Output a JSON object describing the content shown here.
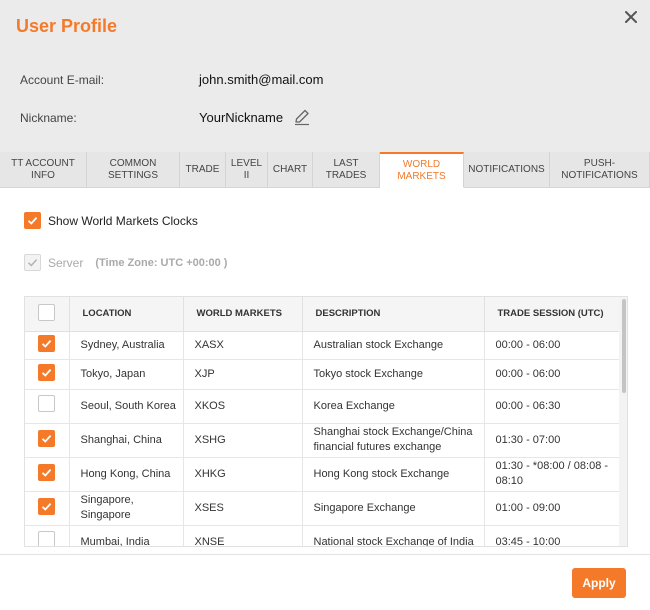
{
  "dialog": {
    "title": "User Profile",
    "accent_color": "#f47a2a"
  },
  "profile": {
    "email_label": "Account E-mail:",
    "email_value": "john.smith@mail.com",
    "nickname_label": "Nickname:",
    "nickname_value": "YourNickname"
  },
  "tabs": [
    {
      "label": "TT ACCOUNT\nINFO",
      "active": false
    },
    {
      "label": "COMMON\nSETTINGS",
      "active": false
    },
    {
      "label": "TRADE",
      "active": false
    },
    {
      "label": "LEVEL\nII",
      "active": false
    },
    {
      "label": "CHART",
      "active": false
    },
    {
      "label": "LAST\nTRADES",
      "active": false
    },
    {
      "label": "WORLD\nMARKETS",
      "active": true
    },
    {
      "label": "NOTIFICATIONS",
      "active": false
    },
    {
      "label": "PUSH-\nNOTIFICATIONS",
      "active": false
    }
  ],
  "options": {
    "show_clocks_label": "Show World Markets Clocks",
    "show_clocks_checked": true,
    "server_label": "Server",
    "server_checked": true,
    "timezone_text": "(Time Zone: UTC +00:00 )"
  },
  "table": {
    "columns": [
      "LOCATION",
      "WORLD MARKETS",
      "DESCRIPTION",
      "TRADE SESSION (UTC)"
    ],
    "rows": [
      {
        "checked": true,
        "location": "Sydney, Australia",
        "market": "XASX",
        "description": "Australian stock Exchange",
        "session": "00:00 - 06:00"
      },
      {
        "checked": true,
        "location": "Tokyo, Japan",
        "market": "XJP",
        "description": "Tokyo stock Exchange",
        "session": "00:00 - 06:00"
      },
      {
        "checked": false,
        "location": "Seoul, South Korea",
        "market": "XKOS",
        "description": "Korea Exchange",
        "session": "00:00 - 06:30"
      },
      {
        "checked": true,
        "location": "Shanghai, China",
        "market": "XSHG",
        "description": "Shanghai stock Exchange/China financial futures exchange",
        "session": "01:30 - 07:00"
      },
      {
        "checked": true,
        "location": "Hong Kong, China",
        "market": "XHKG",
        "description": "Hong Kong stock Exchange",
        "session": "01:30 - *08:00 / 08:08 - 08:10"
      },
      {
        "checked": true,
        "location": "Singapore, Singapore",
        "market": "XSES",
        "description": "Singapore Exchange",
        "session": "01:00 - 09:00"
      },
      {
        "checked": false,
        "location": "Mumbai, India",
        "market": "XNSE",
        "description": "National stock Exchange of India",
        "session": "03:45 - 10:00"
      }
    ]
  },
  "footer": {
    "apply_label": "Apply"
  }
}
